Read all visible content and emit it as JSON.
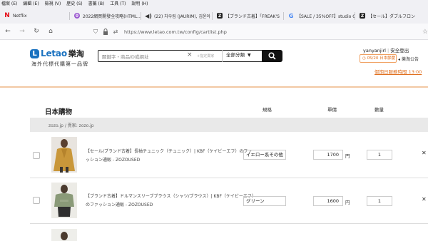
{
  "browser": {
    "menu": [
      "檔案 (E)",
      "編輯 (E)",
      "檢視 (V)",
      "歷史 (S)",
      "書籤 (B)",
      "工具 (T)",
      "說明 (H)"
    ],
    "tabs": [
      {
        "label": "Netflix",
        "icon": "netflix-icon"
      },
      {
        "label": "2022網買開發全攻略(HTML...",
        "icon": "purple-circle-icon"
      },
      {
        "label": "(22) 차우림 (JAURIM), 김윤아",
        "icon": "speaker-icon"
      },
      {
        "label": "【ブランド古着】「FREAK'S",
        "icon": "store-icon"
      },
      {
        "label": "【SALE / 35%OFF】studio C",
        "icon": "google-icon"
      },
      {
        "label": "【セール】ダブルフロン",
        "icon": "store-icon"
      }
    ],
    "url": "https://www.letao.com.tw/config/cartlist.php"
  },
  "site": {
    "logo_text": "Letao",
    "logo_cn": "樂淘",
    "tagline": "海外代標代購第一品牌",
    "search_placeholder": "關鍵字・商品ID或網址",
    "search_spec": "+指定賣家",
    "category": "全部分類",
    "username": "yanyanjirl",
    "logout": "安全登出",
    "notice": "05/20 日本節慶",
    "notice_link": "樂淘公告",
    "holiday_link": "假期日服務時間 13:00"
  },
  "cart": {
    "title": "日本購物",
    "headers": {
      "spec": "規格",
      "price": "單價",
      "qty": "數量"
    },
    "shop_label": "zozo.jp / 賣家: zozo.jp",
    "currency_unit": "円",
    "items": [
      {
        "title": "【セール/ブランド古着】長袖チュニック（チュニック）| KBF（ケイビーエフ）のファッション通販 - ZOZOUSED",
        "spec": "イエロー系その他",
        "price": "1700",
        "qty": "1"
      },
      {
        "title": "【ブランド古着】ドルマンスリーブブラウス（シャツ/ブラウス）| KBF（ケイビーエフ）のファッション通販 - ZOZOUSED",
        "spec": "グリーン",
        "price": "1600",
        "qty": "1"
      }
    ]
  }
}
